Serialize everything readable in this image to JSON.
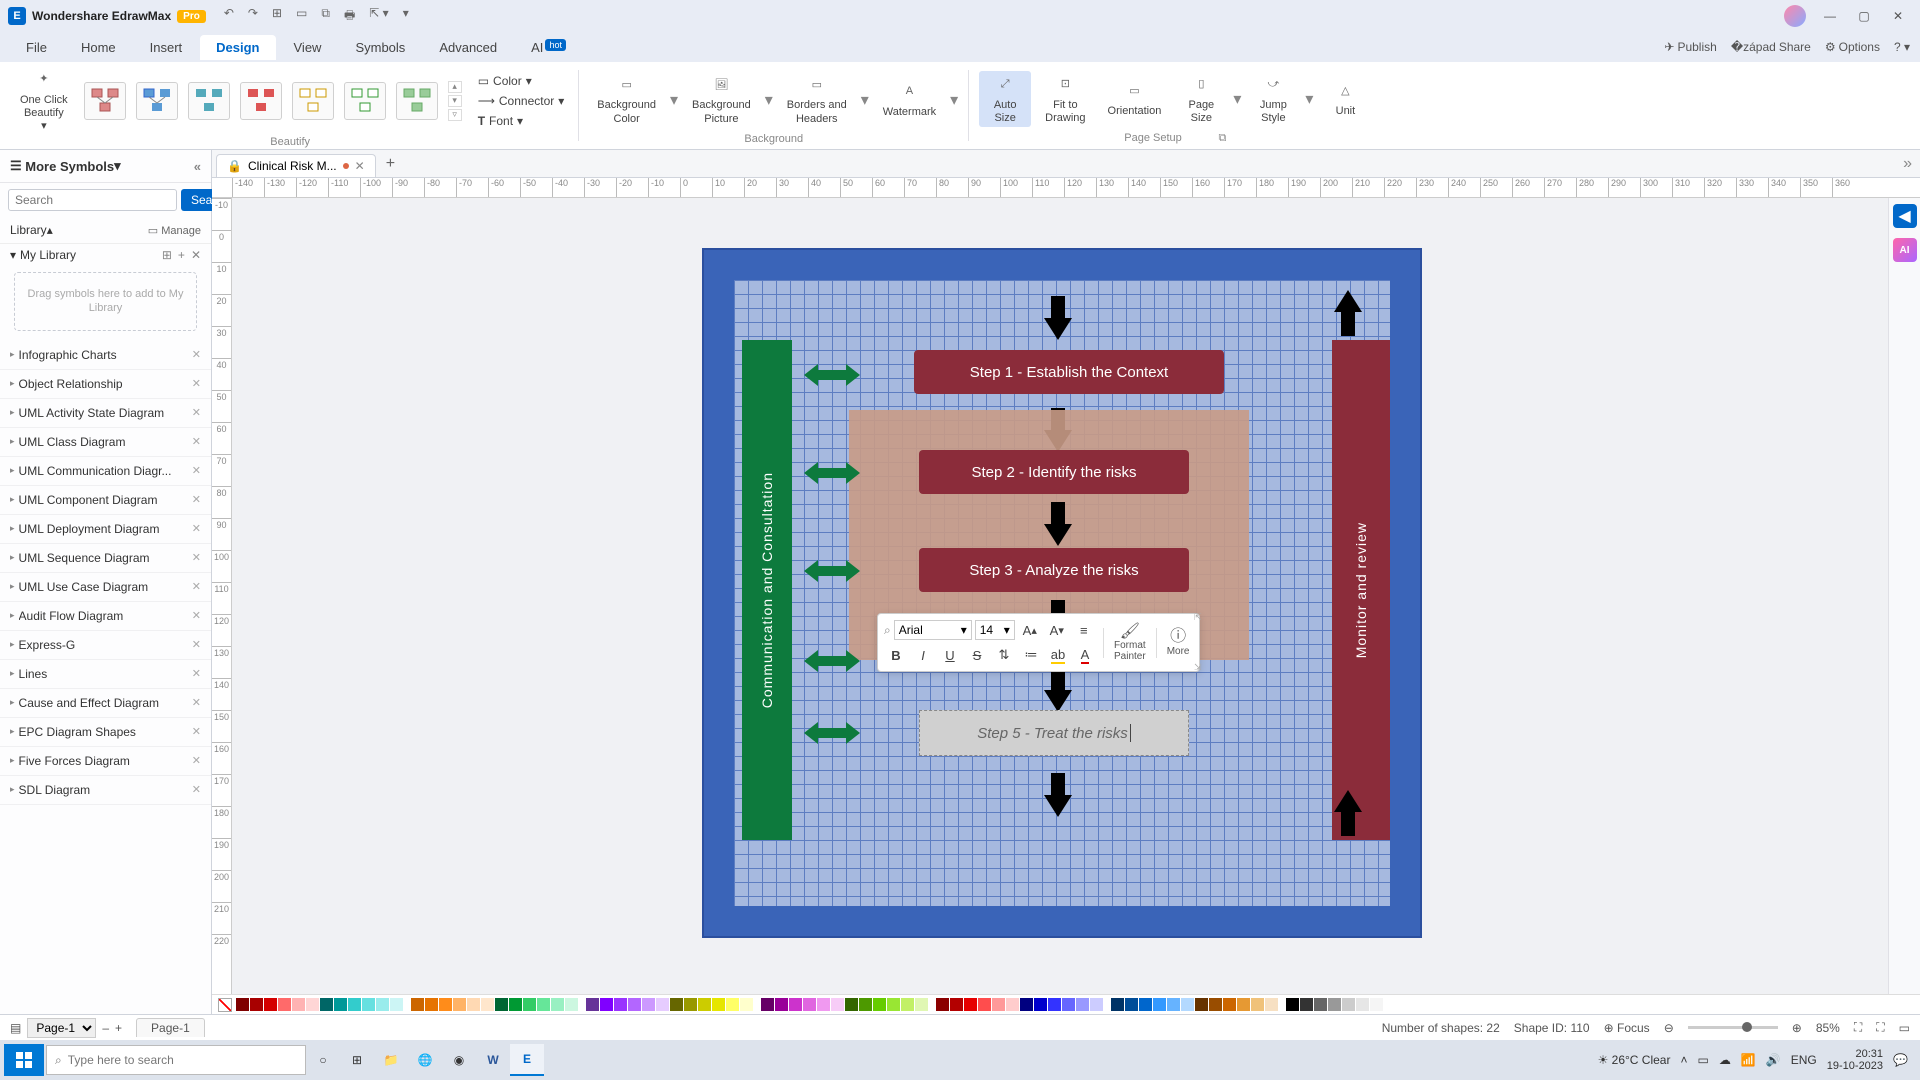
{
  "app": {
    "name": "Wondershare EdrawMax",
    "badge": "Pro"
  },
  "menu": {
    "items": [
      "File",
      "Home",
      "Insert",
      "Design",
      "View",
      "Symbols",
      "Advanced",
      "AI"
    ],
    "active": "Design",
    "hot_on": "AI",
    "right": [
      "Publish",
      "Share",
      "Options"
    ]
  },
  "ribbon": {
    "oneclick": "One Click\nBeautify",
    "group_beautify": "Beautify",
    "color": "Color",
    "connector": "Connector",
    "font": "Font",
    "bg_color": "Background\nColor",
    "bg_pic": "Background\nPicture",
    "borders": "Borders and\nHeaders",
    "watermark": "Watermark",
    "group_bg": "Background",
    "autosize": "Auto\nSize",
    "fit": "Fit to\nDrawing",
    "orientation": "Orientation",
    "pagesize": "Page\nSize",
    "jump": "Jump\nStyle",
    "unit": "Unit",
    "group_ps": "Page Setup"
  },
  "doctab": {
    "title": "Clinical Risk M...",
    "modified": true
  },
  "sidebar": {
    "title": "More Symbols",
    "search_ph": "Search",
    "search_btn": "Search",
    "library": "Library",
    "manage": "Manage",
    "mylib": "My Library",
    "dropzone": "Drag symbols here to add to My Library",
    "cats": [
      "Infographic Charts",
      "Object Relationship",
      "UML Activity State Diagram",
      "UML Class Diagram",
      "UML Communication Diagr...",
      "UML Component Diagram",
      "UML Deployment Diagram",
      "UML Sequence Diagram",
      "UML Use Case Diagram",
      "Audit Flow Diagram",
      "Express-G",
      "Lines",
      "Cause and Effect Diagram",
      "EPC Diagram Shapes",
      "Five Forces Diagram",
      "SDL Diagram"
    ]
  },
  "diagram": {
    "left_label": "Communication and Consultation",
    "right_label": "Monitor and review",
    "step1": "Step 1 - Establish the Context",
    "step2": "Step 2 - Identify the risks",
    "step3": "Step 3 - Analyze the risks",
    "step5": "Step 5 - Treat the risks"
  },
  "float": {
    "font": "Arial",
    "size": "14",
    "format_painter": "Format\nPainter",
    "more": "More"
  },
  "palette": [
    "#7f0000",
    "#a80000",
    "#d40000",
    "#ff6a6a",
    "#ffb3b3",
    "#ffd6d6",
    "#006666",
    "#009999",
    "#33cccc",
    "#66e0e0",
    "#99ecec",
    "#ccf5f5",
    "",
    "#cc6600",
    "#e67300",
    "#ff8c1a",
    "#ffb366",
    "#ffd9b3",
    "#ffe6cc",
    "#006633",
    "#009933",
    "#33cc66",
    "#66e699",
    "#99f0c2",
    "#ccf7e0",
    "",
    "#663399",
    "#8000ff",
    "#9933ff",
    "#b366ff",
    "#cc99ff",
    "#e6ccff",
    "#666600",
    "#999900",
    "#cccc00",
    "#e6e600",
    "#ffff66",
    "#ffffcc",
    "",
    "#660066",
    "#990099",
    "#cc33cc",
    "#e066e0",
    "#f099f0",
    "#f7ccf7",
    "#336600",
    "#4d9900",
    "#66cc00",
    "#99e633",
    "#c2f066",
    "#e0f7b3",
    "",
    "#8b0000",
    "#b30000",
    "#e60000",
    "#ff4d4d",
    "#ff9999",
    "#ffcccc",
    "#000080",
    "#0000cc",
    "#3333ff",
    "#6666ff",
    "#9999ff",
    "#ccccff",
    "",
    "#003366",
    "#004d99",
    "#0066cc",
    "#3399ff",
    "#66b3ff",
    "#b3d9ff",
    "#663300",
    "#994d00",
    "#cc6600",
    "#e69933",
    "#f0c27a",
    "#f7e0c2",
    "",
    "#000000",
    "#333333",
    "#666666",
    "#999999",
    "#cccccc",
    "#e6e6e6",
    "#f5f5f5",
    "#ffffff"
  ],
  "status": {
    "page_sel": "Page-1",
    "page_tab": "Page-1",
    "shapes": "Number of shapes: 22",
    "shapeid": "Shape ID: 110",
    "focus": "Focus",
    "zoom": "85%"
  },
  "taskbar": {
    "search_ph": "Type here to search",
    "weather": "26°C  Clear",
    "lang": "ENG",
    "time": "20:31",
    "date": "19-10-2023"
  },
  "ruler_h": [
    -140,
    -130,
    -120,
    -110,
    -100,
    -90,
    -80,
    -70,
    -60,
    -50,
    -40,
    -30,
    -20,
    -10,
    0,
    10,
    20,
    30,
    40,
    50,
    60,
    70,
    80,
    90,
    100,
    110,
    120,
    130,
    140,
    150,
    160,
    170,
    180,
    190,
    200,
    210,
    220,
    230,
    240,
    250,
    260,
    270,
    280,
    290,
    300,
    310,
    320,
    330,
    340,
    350,
    360
  ],
  "ruler_v": [
    -10,
    0,
    10,
    20,
    30,
    40,
    50,
    60,
    70,
    80,
    90,
    100,
    110,
    120,
    130,
    140,
    150,
    160,
    170,
    180,
    190,
    200,
    210,
    220
  ]
}
